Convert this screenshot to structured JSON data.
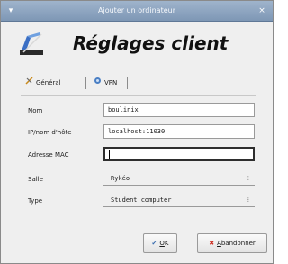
{
  "window": {
    "title": "Ajouter un ordinateur",
    "menu_icon": "window-menu-icon",
    "close_symbol": "×"
  },
  "header": {
    "title": "Réglages client",
    "icon": "client-settings-icon"
  },
  "tabs": [
    {
      "label": "Général",
      "icon": "tools-icon",
      "active": true
    },
    {
      "label": "VPN",
      "icon": "network-icon",
      "active": false
    }
  ],
  "form": {
    "nom": {
      "label": "Nom",
      "value": "boulinix"
    },
    "hostname": {
      "label": "IP/nom d'hôte",
      "value": "localhost:11030"
    },
    "mac": {
      "label": "Adresse MAC",
      "value": ""
    },
    "salle": {
      "label": "Salle",
      "value": "Rykéo"
    },
    "type": {
      "label": "Type",
      "value": "Student computer"
    }
  },
  "buttons": {
    "ok": {
      "accel": "O",
      "rest": "K",
      "icon": "checkmark-icon"
    },
    "cancel": {
      "accel": "A",
      "rest": "bandonner",
      "icon": "cancel-x-icon"
    }
  },
  "colors": {
    "titlebar": "#8aa2bf",
    "ok_icon": "#3d6fb0",
    "cancel_icon": "#cc2a1e"
  }
}
